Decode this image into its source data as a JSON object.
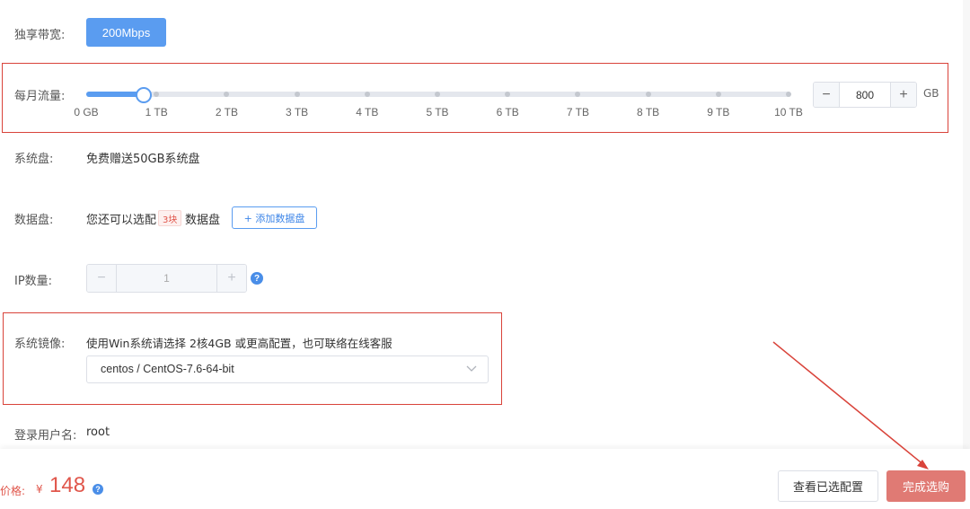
{
  "bandwidth": {
    "label": "独享带宽:",
    "value": "200Mbps"
  },
  "traffic": {
    "label": "每月流量:",
    "ticks": [
      "0 GB",
      "1 TB",
      "2 TB",
      "3 TB",
      "4 TB",
      "5 TB",
      "6 TB",
      "7 TB",
      "8 TB",
      "9 TB",
      "10 TB"
    ],
    "slider_fraction": 0.08,
    "stepper": {
      "minus": "−",
      "value": "800",
      "plus": "+"
    },
    "unit": "GB"
  },
  "system_disk": {
    "label": "系统盘:",
    "text": "免费赠送50GB系统盘"
  },
  "data_disk": {
    "label": "数据盘:",
    "prefix": "您还可以选配",
    "badge": "3块",
    "suffix": "数据盘",
    "add_button": "+ 添加数据盘"
  },
  "ip": {
    "label": "IP数量:",
    "stepper": {
      "minus": "−",
      "value": "1",
      "plus": "+"
    },
    "help": "?"
  },
  "image": {
    "label": "系统镜像:",
    "hint": "使用Win系统请选择 2核4GB 或更高配置，也可联络在线客服",
    "selected": "centos / CentOS-7.6-64-bit"
  },
  "login": {
    "label": "登录用户名:",
    "value": "root"
  },
  "footer": {
    "price_label": "价格:",
    "currency": "¥",
    "price": "148",
    "help": "?",
    "view_config": "查看已选配置",
    "finish": "完成选购"
  },
  "colors": {
    "accent": "#5a9cf0",
    "highlight_border": "#d9433a",
    "price": "#e0564b",
    "finish_button": "#e07a74"
  }
}
